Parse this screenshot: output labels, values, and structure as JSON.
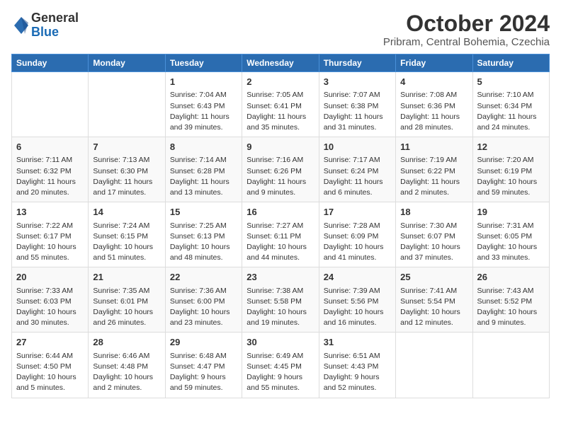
{
  "header": {
    "logo_line1": "General",
    "logo_line2": "Blue",
    "month": "October 2024",
    "location": "Pribram, Central Bohemia, Czechia"
  },
  "days_of_week": [
    "Sunday",
    "Monday",
    "Tuesday",
    "Wednesday",
    "Thursday",
    "Friday",
    "Saturday"
  ],
  "weeks": [
    [
      {
        "day": "",
        "info": ""
      },
      {
        "day": "",
        "info": ""
      },
      {
        "day": "1",
        "info": "Sunrise: 7:04 AM\nSunset: 6:43 PM\nDaylight: 11 hours\nand 39 minutes."
      },
      {
        "day": "2",
        "info": "Sunrise: 7:05 AM\nSunset: 6:41 PM\nDaylight: 11 hours\nand 35 minutes."
      },
      {
        "day": "3",
        "info": "Sunrise: 7:07 AM\nSunset: 6:38 PM\nDaylight: 11 hours\nand 31 minutes."
      },
      {
        "day": "4",
        "info": "Sunrise: 7:08 AM\nSunset: 6:36 PM\nDaylight: 11 hours\nand 28 minutes."
      },
      {
        "day": "5",
        "info": "Sunrise: 7:10 AM\nSunset: 6:34 PM\nDaylight: 11 hours\nand 24 minutes."
      }
    ],
    [
      {
        "day": "6",
        "info": "Sunrise: 7:11 AM\nSunset: 6:32 PM\nDaylight: 11 hours\nand 20 minutes."
      },
      {
        "day": "7",
        "info": "Sunrise: 7:13 AM\nSunset: 6:30 PM\nDaylight: 11 hours\nand 17 minutes."
      },
      {
        "day": "8",
        "info": "Sunrise: 7:14 AM\nSunset: 6:28 PM\nDaylight: 11 hours\nand 13 minutes."
      },
      {
        "day": "9",
        "info": "Sunrise: 7:16 AM\nSunset: 6:26 PM\nDaylight: 11 hours\nand 9 minutes."
      },
      {
        "day": "10",
        "info": "Sunrise: 7:17 AM\nSunset: 6:24 PM\nDaylight: 11 hours\nand 6 minutes."
      },
      {
        "day": "11",
        "info": "Sunrise: 7:19 AM\nSunset: 6:22 PM\nDaylight: 11 hours\nand 2 minutes."
      },
      {
        "day": "12",
        "info": "Sunrise: 7:20 AM\nSunset: 6:19 PM\nDaylight: 10 hours\nand 59 minutes."
      }
    ],
    [
      {
        "day": "13",
        "info": "Sunrise: 7:22 AM\nSunset: 6:17 PM\nDaylight: 10 hours\nand 55 minutes."
      },
      {
        "day": "14",
        "info": "Sunrise: 7:24 AM\nSunset: 6:15 PM\nDaylight: 10 hours\nand 51 minutes."
      },
      {
        "day": "15",
        "info": "Sunrise: 7:25 AM\nSunset: 6:13 PM\nDaylight: 10 hours\nand 48 minutes."
      },
      {
        "day": "16",
        "info": "Sunrise: 7:27 AM\nSunset: 6:11 PM\nDaylight: 10 hours\nand 44 minutes."
      },
      {
        "day": "17",
        "info": "Sunrise: 7:28 AM\nSunset: 6:09 PM\nDaylight: 10 hours\nand 41 minutes."
      },
      {
        "day": "18",
        "info": "Sunrise: 7:30 AM\nSunset: 6:07 PM\nDaylight: 10 hours\nand 37 minutes."
      },
      {
        "day": "19",
        "info": "Sunrise: 7:31 AM\nSunset: 6:05 PM\nDaylight: 10 hours\nand 33 minutes."
      }
    ],
    [
      {
        "day": "20",
        "info": "Sunrise: 7:33 AM\nSunset: 6:03 PM\nDaylight: 10 hours\nand 30 minutes."
      },
      {
        "day": "21",
        "info": "Sunrise: 7:35 AM\nSunset: 6:01 PM\nDaylight: 10 hours\nand 26 minutes."
      },
      {
        "day": "22",
        "info": "Sunrise: 7:36 AM\nSunset: 6:00 PM\nDaylight: 10 hours\nand 23 minutes."
      },
      {
        "day": "23",
        "info": "Sunrise: 7:38 AM\nSunset: 5:58 PM\nDaylight: 10 hours\nand 19 minutes."
      },
      {
        "day": "24",
        "info": "Sunrise: 7:39 AM\nSunset: 5:56 PM\nDaylight: 10 hours\nand 16 minutes."
      },
      {
        "day": "25",
        "info": "Sunrise: 7:41 AM\nSunset: 5:54 PM\nDaylight: 10 hours\nand 12 minutes."
      },
      {
        "day": "26",
        "info": "Sunrise: 7:43 AM\nSunset: 5:52 PM\nDaylight: 10 hours\nand 9 minutes."
      }
    ],
    [
      {
        "day": "27",
        "info": "Sunrise: 6:44 AM\nSunset: 4:50 PM\nDaylight: 10 hours\nand 5 minutes."
      },
      {
        "day": "28",
        "info": "Sunrise: 6:46 AM\nSunset: 4:48 PM\nDaylight: 10 hours\nand 2 minutes."
      },
      {
        "day": "29",
        "info": "Sunrise: 6:48 AM\nSunset: 4:47 PM\nDaylight: 9 hours\nand 59 minutes."
      },
      {
        "day": "30",
        "info": "Sunrise: 6:49 AM\nSunset: 4:45 PM\nDaylight: 9 hours\nand 55 minutes."
      },
      {
        "day": "31",
        "info": "Sunrise: 6:51 AM\nSunset: 4:43 PM\nDaylight: 9 hours\nand 52 minutes."
      },
      {
        "day": "",
        "info": ""
      },
      {
        "day": "",
        "info": ""
      }
    ]
  ]
}
